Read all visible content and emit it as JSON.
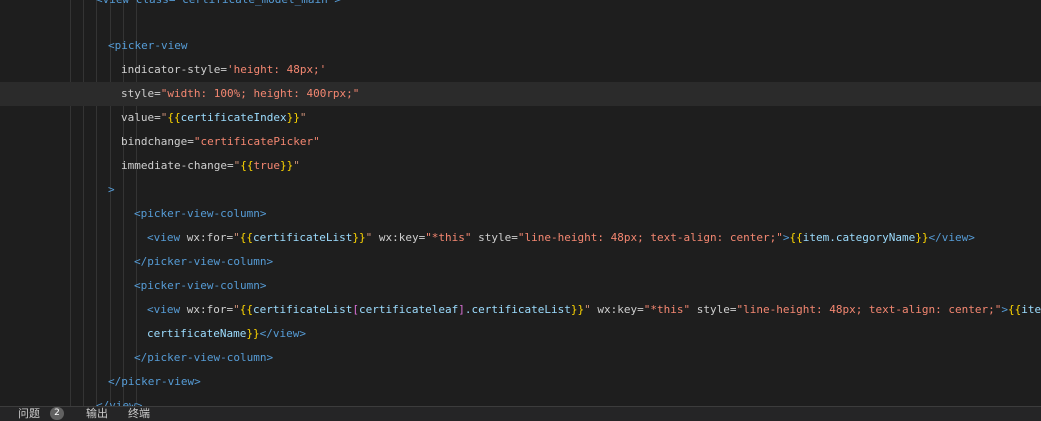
{
  "editor": {
    "lines": {
      "l0": {
        "text": "<view class=\"certificate_model_main\">"
      },
      "l1": {
        "tag_open": "<picker-view"
      },
      "l2": {
        "attr": "indicator-style=",
        "value": "'height: 48px;'"
      },
      "l3": {
        "attr": "style=",
        "value": "\"width: 100%; height: 400rpx;\""
      },
      "l4": {
        "attr": "value=",
        "q1": "\"",
        "b_open": "{{",
        "expr": "certificateIndex",
        "b_close": "}}",
        "q2": "\""
      },
      "l5": {
        "attr": "bindchange=",
        "value": "\"certificatePicker\""
      },
      "l6": {
        "attr": "immediate-change=",
        "q1": "\"",
        "b_open": "{{",
        "expr": "true",
        "b_close": "}}",
        "q2": "\""
      },
      "l7": {
        "text": ">"
      },
      "l8": {
        "text": "<picker-view-column>"
      },
      "l9": {
        "tag_open": "<view ",
        "attr1": "wx:for=",
        "q1": "\"",
        "b_open": "{{",
        "expr": "certificateList",
        "b_close": "}}",
        "q2": "\" ",
        "attr2": "wx:key=",
        "val2": "\"*this\" ",
        "attr3": "style=",
        "val3": "\"line-height: 48px; text-align: center;\"",
        "gt": ">",
        "b_open2": "{{",
        "expr2": "item.categoryName",
        "b_close2": "}}",
        "tag_close": "</view>"
      },
      "l10": {
        "text": "</picker-view-column>"
      },
      "l11": {
        "text": "<picker-view-column>"
      },
      "l12": {
        "tag_open": "<view ",
        "attr1": "wx:for=",
        "q1": "\"",
        "b_open": "{{",
        "expr": "certificateList",
        "br_open": "[",
        "expr_b": "certificateleaf",
        "br_close": "]",
        "expr_c": ".certificateList",
        "b_close": "}}",
        "q2": "\" ",
        "attr2": "wx:key=",
        "val2": "\"*this\" ",
        "attr3": "style=",
        "val3": "\"line-height: 48px; text-align: center;\"",
        "gt": ">",
        "b_open2": "{{",
        "expr2": "item."
      },
      "l13": {
        "expr": "certificateName",
        "b_close": "}}",
        "tag_close": "</view>"
      },
      "l14": {
        "text": "</picker-view-column>"
      },
      "l15": {
        "text": "</picker-view>"
      },
      "l16": {
        "text": "</view>"
      }
    }
  },
  "panel": {
    "problems_label": "问题",
    "problems_count": "2",
    "output_label": "输出",
    "terminal_label": "终端"
  }
}
